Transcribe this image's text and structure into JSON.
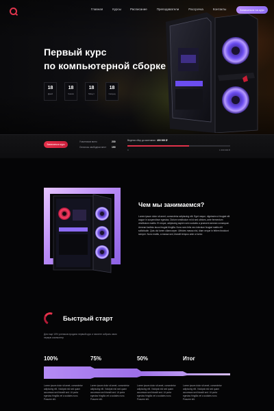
{
  "nav": {
    "items": [
      "Главная",
      "Курсы",
      "Расписание",
      "Преподаватели",
      "Рассрочка",
      "Контакты"
    ],
    "cta": "Записаться на курс"
  },
  "hero": {
    "title_line1": "Первый курс",
    "title_line2": "по компьютерной сборке",
    "counters": [
      {
        "value": "18",
        "label": "Дней"
      },
      {
        "value": "18",
        "label": "Часов"
      },
      {
        "value": "18",
        "label": "Минут"
      },
      {
        "value": "18",
        "label": "Секунд"
      }
    ]
  },
  "funding": {
    "enroll_button": "Записаться курс",
    "stat1_label": "Участников всего",
    "stat1_value": "230",
    "stat2_label": "Осталось свободных мест",
    "stat2_value": "190",
    "raised_label": "Ведется сбор до окончания",
    "raised_value": "400 000 ₽",
    "progress_fraction": 0.6,
    "tick_start": "0",
    "tick_end": "1 000 000 ₽"
  },
  "about": {
    "title": "Чем мы занимаемся?",
    "text": "Lorem ipsum dolor sit amet, consectetur adipiscing elit. Eget neque, dignissim ut feugiat elit augue in suspendisse egestas. Dictum vestibulum mi id sed ultrices, ante fermentum vestibulum mattis. Et neque, adipiscing sapien sem sodales a praesent aenean consequat. Aenean facilisis lacus feugiat fringilla. Nunc sem felis nec interdum feugiat mattis elit sollicitudin. Quis dui lorem ullamcorper. Ultricies massa nisi, diam neque in fellem tincidunt semper. Nunc mattis, a massa sed, blandit tempus ante ut tortor."
  },
  "quick_start": {
    "title": "Быстрый старт",
    "text": "Для еще 10% учеников продано первый курс и начнете собрать свою первую компьютер",
    "steps": [
      {
        "label": "100%",
        "text": "Lorem ipsum dolor sit amet, consectetur adipiscing elit. Volutpat nisl sed quam accumsan sed blandit sed. Ut porta egestas fringilla vel a sodales nunc. Posuere elit."
      },
      {
        "label": "75%",
        "text": "Lorem ipsum dolor sit amet, consectetur adipiscing elit. Volutpat nisl sed quam accumsan sed blandit sed. Ut porta egestas fringilla vel a sodales nunc. Posuere elit."
      },
      {
        "label": "50%",
        "text": "Lorem ipsum dolor sit amet, consectetur adipiscing elit. Volutpat nisl sed quam accumsan sed blandit sed. Ut porta egestas fringilla vel a sodales nunc. Posuere elit."
      },
      {
        "label": "Итог",
        "text": "Lorem ipsum dolor sit amet, consectetur adipiscing elit. Volutpat nisl sed quam accumsan sed blandit sed. Ut porta egestas fringilla vel a sodales nunc. Posuere elit."
      }
    ]
  },
  "colors": {
    "accent": "#e1314a",
    "purple": "#a57ff0",
    "background": "#050506"
  }
}
